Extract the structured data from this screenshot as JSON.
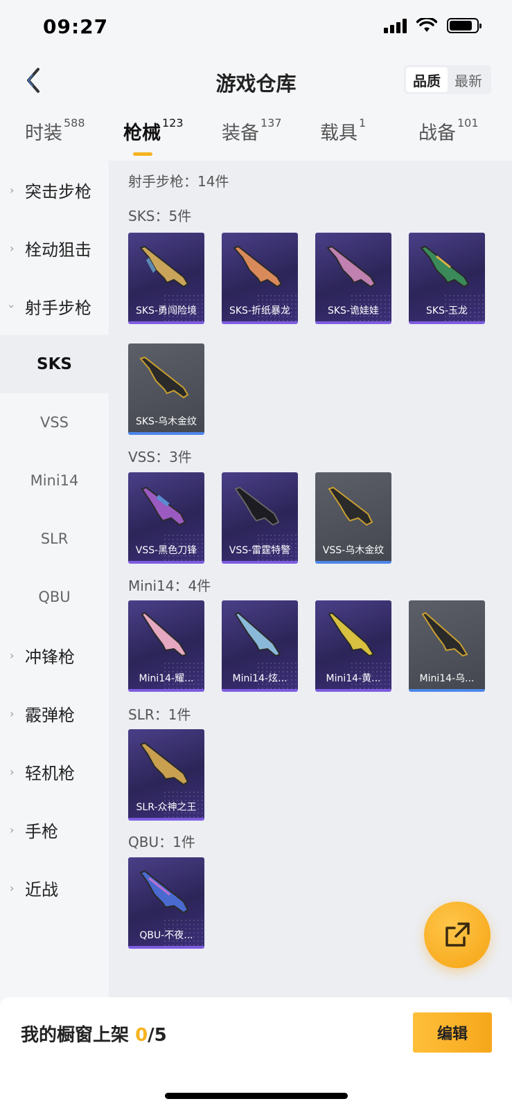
{
  "status_bar": {
    "time": "09:27"
  },
  "header": {
    "title": "游戏仓库",
    "sort": {
      "quality": "品质",
      "newest": "最新"
    }
  },
  "tabs": [
    {
      "label": "时装",
      "count": "588"
    },
    {
      "label": "枪械",
      "count": "123"
    },
    {
      "label": "装备",
      "count": "137"
    },
    {
      "label": "载具",
      "count": "1"
    },
    {
      "label": "战备",
      "count": "101"
    }
  ],
  "sidebar": {
    "categories": [
      {
        "label": "突击步枪"
      },
      {
        "label": "栓动狙击"
      },
      {
        "label": "射手步枪"
      }
    ],
    "subcategories": [
      "SKS",
      "VSS",
      "Mini14",
      "SLR",
      "QBU"
    ],
    "more_categories": [
      {
        "label": "冲锋枪"
      },
      {
        "label": "霰弹枪"
      },
      {
        "label": "轻机枪"
      },
      {
        "label": "手枪"
      },
      {
        "label": "近战"
      }
    ]
  },
  "content": {
    "group_title": "射手步枪：14件",
    "sections": [
      {
        "title": "SKS：5件",
        "items": [
          "SKS-勇闯险境",
          "SKS-折纸暴龙",
          "SKS-诡娃娃",
          "SKS-玉龙",
          "SKS-乌木金纹"
        ]
      },
      {
        "title": "VSS：3件",
        "items": [
          "VSS-黑色刀锋",
          "VSS-雷霆特警",
          "VSS-乌木金纹"
        ]
      },
      {
        "title": "Mini14：4件",
        "items": [
          "Mini14-耀...",
          "Mini14-炫...",
          "Mini14-黄...",
          "Mini14-乌..."
        ]
      },
      {
        "title": "SLR：1件",
        "items": [
          "SLR-众神之王"
        ]
      },
      {
        "title": "QBU：1件",
        "items": [
          "QBU-不夜..."
        ]
      }
    ]
  },
  "bottom": {
    "showcase_label": "我的橱窗上架",
    "showcase_current": "0",
    "showcase_total": "/5",
    "edit_label": "编辑"
  },
  "colors": {
    "accent": "#f5b320",
    "epic_card": "#2c2558",
    "common_card": "#4a4d55"
  },
  "icons": {
    "back": "chevron-left-icon",
    "share": "external-link-icon"
  }
}
